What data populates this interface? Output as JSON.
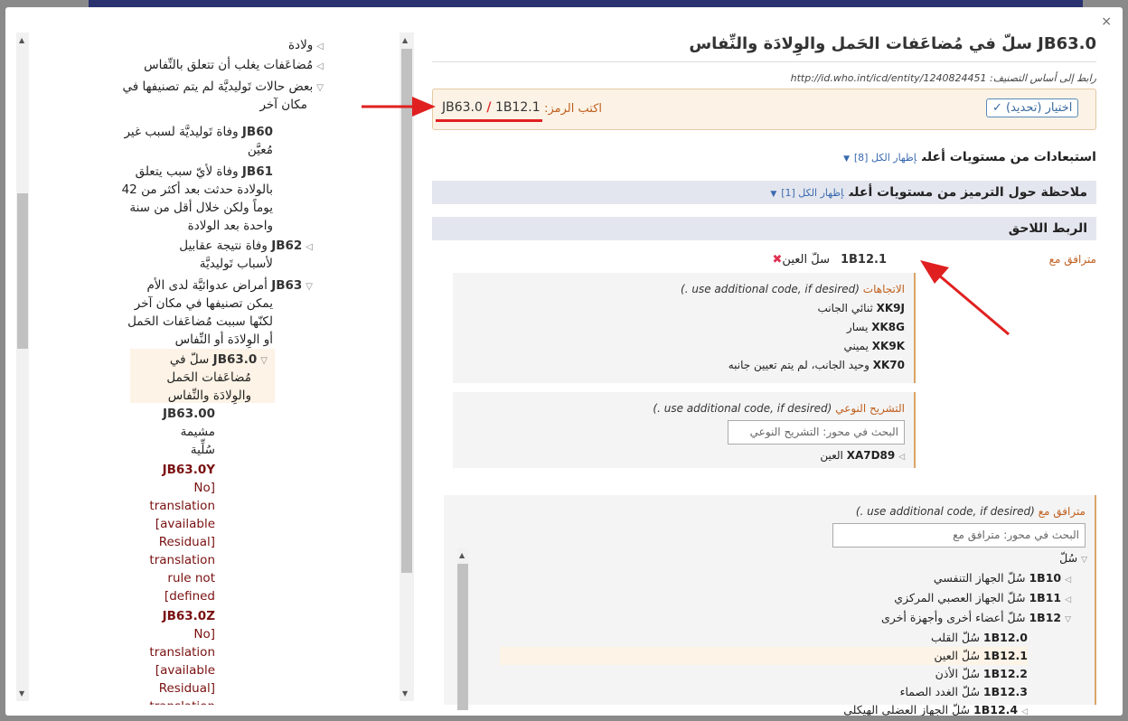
{
  "close_label": "×",
  "left_tree": {
    "items": [
      {
        "tri": "◁",
        "code": "",
        "text": "ولادة",
        "lines": 1
      },
      {
        "tri": "◁",
        "code": "",
        "text": "مُضاعَفات يغلب أن تتعلق بالنِّفاس"
      },
      {
        "tri": "▽",
        "code": "",
        "text": "بعض حالات تَوليديَّة لم يتم تصنيفها في",
        "text2": "مكان آخر"
      },
      {
        "code": "JB60",
        "text": "وفاة تَوليديَّة لسبب غير",
        "text2": "مُعيَّن"
      },
      {
        "code": "JB61",
        "text": "وفاة لأيّ سبب يتعلق",
        "text2": "بالولادة حدثت بعد أكثر من 42",
        "text3": "يوماً ولكن خلال أقل من سنة",
        "text4": "واحدة بعد الولادة"
      },
      {
        "tri": "◁",
        "code": "JB62",
        "text": "وفاة نتيجة عقابيل",
        "text2": "لأسباب تَوليديَّة"
      },
      {
        "tri": "▽",
        "code": "JB63",
        "text": "أمراض عدوائيَّة لدى الأم",
        "text2": "يمكن تصنيفها في مكان آخر",
        "text3": "لكنّها سببت مُضاعَفات الحَمل",
        "text4": "أو الوِلادَة أو النِّفاس"
      },
      {
        "tri": "▽",
        "code": "JB63.0",
        "text": "سلّ في",
        "text2": "مُضاعَفات الحَمل",
        "text3": "والوِلادَة والنِّفاس"
      },
      {
        "code": "JB63.00",
        "text": "مشيمة",
        "text2": "سُلِّية"
      },
      {
        "code": "JB63.0Y",
        "text": "[No",
        "text2": "translation",
        "text3": "available]",
        "text4": "[Residual",
        "text5": "translation",
        "text6": "rule not",
        "text7": "defined]"
      },
      {
        "code": "JB63.0Z",
        "text": "[No",
        "text2": "translation",
        "text3": "available]",
        "text4": "[Residual",
        "text5": "translation"
      }
    ]
  },
  "detail": {
    "title": "JB63.0 سلّ في مُضاعَفات الحَمل والوِلادَة والنِّفاس",
    "uri_label": "رابط إلى أساس التصنيف:",
    "uri": "http://id.who.int/icd/entity/1240824451",
    "code_label": "اكتب الرمز:",
    "code_a": "JB63.0",
    "code_sep": "/",
    "code_b": "1B12.1",
    "choose_label": "اختيار (تحديد) ✓",
    "exclusions_label": "استبعادات من مستويات أعلى",
    "exclusions_show": "إظهار الكل [8]",
    "coding_note_label": "ملاحظة حول الترميز من مستويات أعلى",
    "coding_note_show": "إظهار الكل [1]",
    "postcoord_label": "الربط اللاحق",
    "assoc_label": "مترافق مع",
    "assoc_code": "1B12.1",
    "assoc_text": "سلّ العين",
    "laterality": {
      "title": "الاتجاهات",
      "hint": "(use additional code, if desired .)",
      "items": [
        {
          "code": "XK9J",
          "text": "ثنائي الجانب"
        },
        {
          "code": "XK8G",
          "text": "يسار"
        },
        {
          "code": "XK9K",
          "text": "يميني"
        },
        {
          "code": "XK70",
          "text": "وحيد الجانب، لم يتم تعيين جانبه"
        }
      ]
    },
    "anatomy": {
      "title": "التشريح النوعي",
      "hint": "(use additional code, if desired .)",
      "search_placeholder": "البحث في محور: التشريح النوعي",
      "item_code": "XA7D89",
      "item_text": "العين"
    },
    "assoc_box": {
      "title": "مترافق مع",
      "hint": "(use additional code, if desired .)",
      "search_placeholder": "البحث في محور: مترافق مع",
      "root": "سُلّ",
      "items": [
        {
          "code": "1B10",
          "text": "سُلّ الجهاز التنفسي"
        },
        {
          "code": "1B11",
          "text": "سُلّ الجهاز العصبي المركزي"
        },
        {
          "code": "1B12",
          "text": "سُلّ أعضاء أخرى وأجهزة أخرى"
        },
        {
          "code": "1B12.0",
          "text": "سُلّ القلب"
        },
        {
          "code": "1B12.1",
          "text": "سُلّ العين"
        },
        {
          "code": "1B12.2",
          "text": "سُلّ الأذن"
        },
        {
          "code": "1B12.3",
          "text": "سُلّ الغدد الصماء"
        },
        {
          "code": "1B12.4",
          "text": "سُلّ الجهاز العضلي الهيكلي"
        }
      ]
    }
  },
  "colors": {
    "accent": "#c06020",
    "link": "#3a6ab0",
    "annotation": "#e02020"
  }
}
